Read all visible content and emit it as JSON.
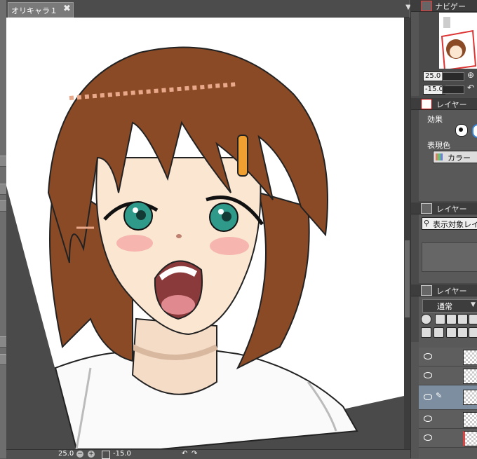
{
  "document_tab": {
    "title": "オリキャラ１",
    "close_glyph": "✖"
  },
  "tab_menu_glyph": "▼",
  "status_bar": {
    "zoom": "25.0",
    "angle": "-15.0",
    "minus": "−",
    "plus": "+"
  },
  "navigator": {
    "title": "ナビゲー",
    "zoom_value": "25.0",
    "angle_value": "-15.0"
  },
  "layer_property": {
    "title": "レイヤー",
    "effect_label": "効果",
    "color_label": "表現色",
    "color_button": "カラー"
  },
  "layer_search": {
    "title": "レイヤー",
    "search_text": "表示対象レイ"
  },
  "layer_panel": {
    "title": "レイヤー",
    "blend_mode": "通常",
    "blend_arrow": "▼"
  },
  "colors": {
    "accent": "#3a86d8",
    "hair": "#8a4a26",
    "eyes": "#2f9a8a",
    "hairpin": "#f0a030",
    "selected_layer": "#7c8ea0"
  },
  "icons": [
    "close-icon",
    "zoom-icon",
    "rotate-icon",
    "eye-icon",
    "search-icon",
    "layer-icon"
  ]
}
